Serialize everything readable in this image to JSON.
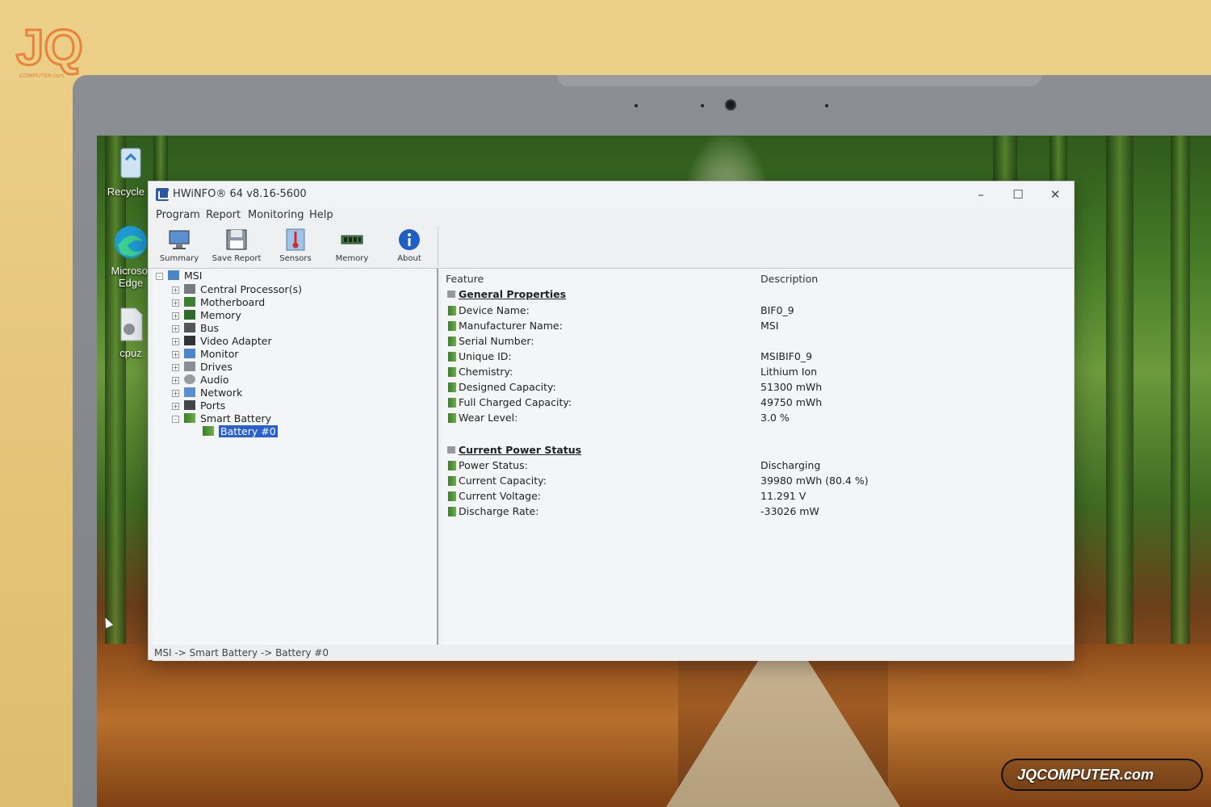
{
  "watermark": {
    "logo_text": "JQ",
    "logo_sub": "COMPUTER.com",
    "badge": "JQCOMPUTER.com"
  },
  "desktop": {
    "icons": [
      {
        "label": "Recycle B"
      },
      {
        "label": "Microsof Edge"
      },
      {
        "label": "cpuz"
      }
    ]
  },
  "window": {
    "title": "HWiNFO® 64 v8.16-5600",
    "controls": {
      "minimize": "–",
      "maximize": "☐",
      "close": "✕"
    }
  },
  "menu": [
    "Program",
    "Report",
    "Monitoring",
    "Help"
  ],
  "toolbar": [
    {
      "label": "Summary",
      "icon": "monitor-icon"
    },
    {
      "label": "Save Report",
      "icon": "floppy-icon"
    },
    {
      "label": "Sensors",
      "icon": "thermometer-icon"
    },
    {
      "label": "Memory",
      "icon": "memory-icon"
    },
    {
      "label": "About",
      "icon": "info-icon"
    }
  ],
  "tree": {
    "root": "MSI",
    "items": [
      {
        "label": "Central Processor(s)",
        "expander": "+"
      },
      {
        "label": "Motherboard",
        "expander": "+"
      },
      {
        "label": "Memory",
        "expander": "+"
      },
      {
        "label": "Bus",
        "expander": "+"
      },
      {
        "label": "Video Adapter",
        "expander": "+"
      },
      {
        "label": "Monitor",
        "expander": "+"
      },
      {
        "label": "Drives",
        "expander": "+"
      },
      {
        "label": "Audio",
        "expander": "+"
      },
      {
        "label": "Network",
        "expander": "+"
      },
      {
        "label": "Ports",
        "expander": "+"
      },
      {
        "label": "Smart Battery",
        "expander": "-"
      }
    ],
    "selected_child": "Battery #0"
  },
  "details": {
    "col_feature": "Feature",
    "col_description": "Description",
    "sections": [
      {
        "title": "General Properties",
        "rows": [
          {
            "name": "Device Name:",
            "value": "BIF0_9"
          },
          {
            "name": "Manufacturer Name:",
            "value": "MSI"
          },
          {
            "name": "Serial Number:",
            "value": ""
          },
          {
            "name": "Unique ID:",
            "value": "MSIBIF0_9"
          },
          {
            "name": "Chemistry:",
            "value": "Lithium Ion"
          },
          {
            "name": "Designed Capacity:",
            "value": "51300 mWh"
          },
          {
            "name": "Full Charged Capacity:",
            "value": "49750 mWh"
          },
          {
            "name": "Wear Level:",
            "value": "3.0 %"
          }
        ]
      },
      {
        "title": "Current Power Status",
        "rows": [
          {
            "name": "Power Status:",
            "value": "Discharging"
          },
          {
            "name": "Current Capacity:",
            "value": "39980 mWh (80.4 %)"
          },
          {
            "name": "Current Voltage:",
            "value": "11.291 V"
          },
          {
            "name": "Discharge Rate:",
            "value": "-33026 mW"
          }
        ]
      }
    ]
  },
  "status_bar": "MSI -> Smart Battery -> Battery #0",
  "colors": {
    "selection": "#2a5fcf",
    "window_bg": "#eef0f2",
    "accent_orange": "#e8833a"
  }
}
